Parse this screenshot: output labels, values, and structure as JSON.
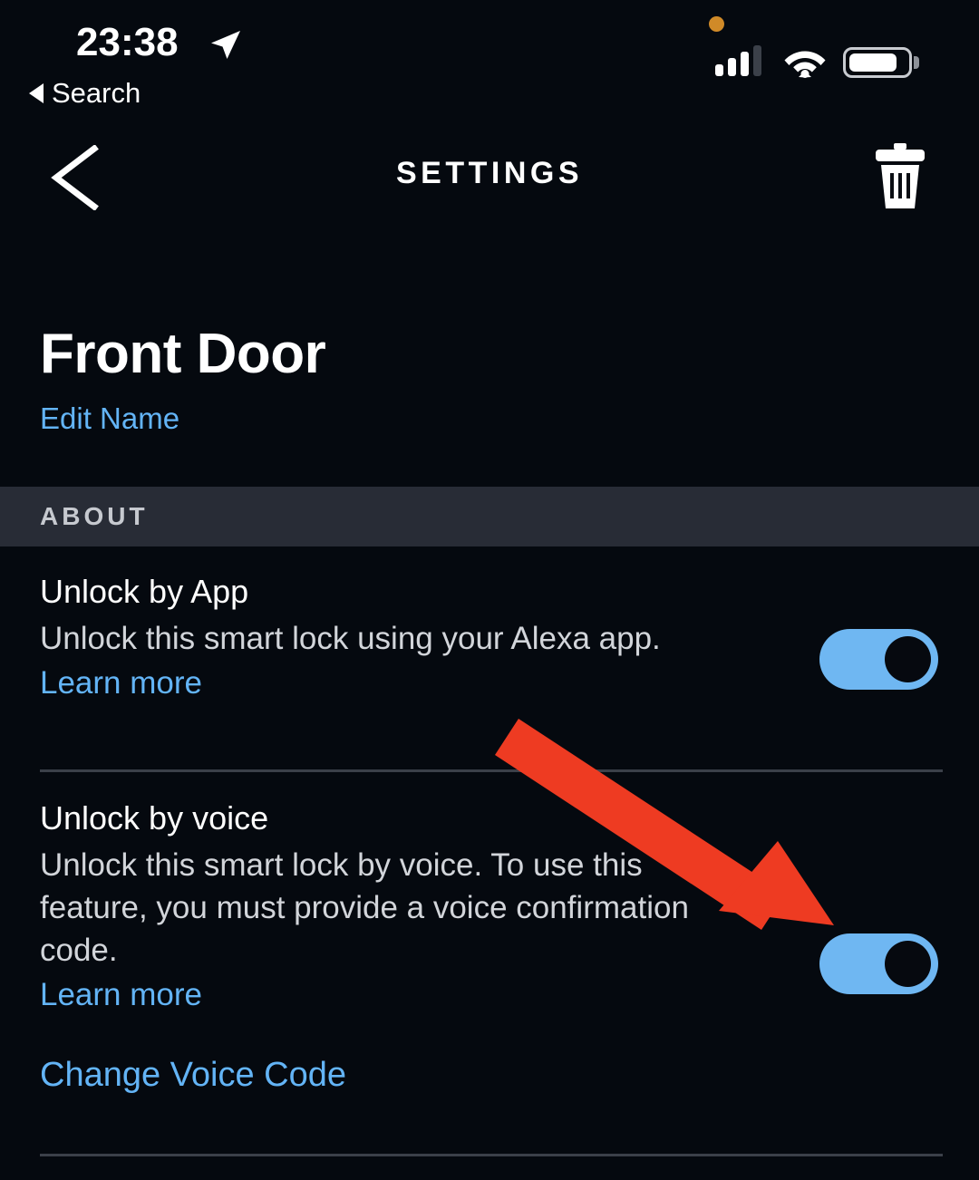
{
  "status_bar": {
    "time": "23:38",
    "location_icon": "location-arrow-icon",
    "back_label": "Search",
    "privacy_dot": "orange-privacy-indicator",
    "cellular_icon": "cellular-signal-icon",
    "cellular_bars_filled": 3,
    "cellular_bars_total": 4,
    "wifi_icon": "wifi-icon",
    "battery_icon": "battery-icon",
    "battery_level_pct": 72
  },
  "nav": {
    "back_icon": "chevron-left-icon",
    "title": "SETTINGS",
    "delete_icon": "trash-icon"
  },
  "device": {
    "name": "Front Door",
    "edit_name_label": "Edit Name"
  },
  "section": {
    "label": "ABOUT"
  },
  "rows": [
    {
      "title": "Unlock by App",
      "description": "Unlock this smart lock using your Alexa app.",
      "link_label": "Learn more",
      "toggle_state": "on"
    },
    {
      "title": "Unlock by voice",
      "description": "Unlock this smart lock by voice. To use this feature, you must provide a voice confirmation code.",
      "link_label": "Learn more",
      "toggle_state": "on"
    }
  ],
  "change_voice_code_label": "Change Voice Code",
  "annotation": {
    "type": "arrow",
    "color": "#ee3b22",
    "points_to": "unlock-by-voice-toggle"
  },
  "colors": {
    "background": "#05090f",
    "section_band": "#282c36",
    "link_blue": "#63b4f6",
    "toggle_on": "#6fb7f2",
    "divider": "#3b4049",
    "text_primary": "#ffffff",
    "text_secondary": "#d2d5da",
    "annotation_red": "#ee3b22"
  }
}
